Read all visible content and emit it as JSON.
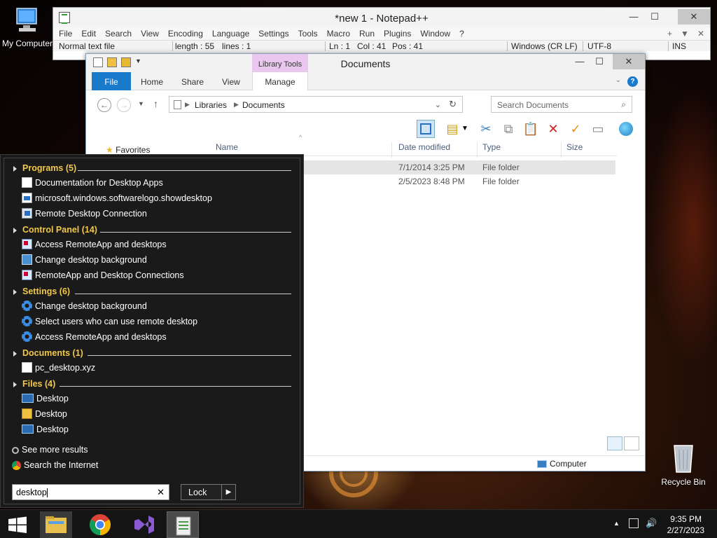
{
  "desktop": {
    "my_computer": "My Computer",
    "recycle_bin": "Recycle Bin"
  },
  "notepad": {
    "title": "*new 1 - Notepad++",
    "menu": [
      "File",
      "Edit",
      "Search",
      "View",
      "Encoding",
      "Language",
      "Settings",
      "Tools",
      "Macro",
      "Run",
      "Plugins",
      "Window",
      "?"
    ],
    "menu_right": [
      "+",
      "▼",
      "✕"
    ],
    "status": {
      "type": "Normal text file",
      "length": "length : 55",
      "lines": "lines : 1",
      "ln": "Ln : 1",
      "col": "Col : 41",
      "pos": "Pos : 41",
      "eol": "Windows (CR LF)",
      "encoding": "UTF-8",
      "mode": "INS"
    }
  },
  "explorer": {
    "title": "Documents",
    "library_tools": "Library Tools",
    "tabs": [
      "File",
      "Home",
      "Share",
      "View",
      "Manage"
    ],
    "breadcrumb": [
      "Libraries",
      "Documents"
    ],
    "search_placeholder": "Search Documents",
    "columns": [
      "Name",
      "Date modified",
      "Type",
      "Size"
    ],
    "rows": [
      {
        "date": "7/1/2014 3:25 PM",
        "type": "File folder"
      },
      {
        "date": "2/5/2023 8:48 PM",
        "type": "File folder"
      }
    ],
    "nav_favorites": "Favorites",
    "status_location": "Computer"
  },
  "start_menu": {
    "categories": [
      {
        "label": "Programs (5)",
        "items": [
          "Documentation for Desktop Apps",
          "microsoft.windows.softwarelogo.showdesktop",
          "Remote Desktop Connection"
        ]
      },
      {
        "label": "Control Panel (14)",
        "items": [
          "Access RemoteApp and desktops",
          "Change desktop background",
          "RemoteApp and Desktop Connections"
        ]
      },
      {
        "label": "Settings (6)",
        "items": [
          "Change desktop background",
          "Select users who can use remote desktop",
          "Access RemoteApp and desktops"
        ]
      },
      {
        "label": "Documents (1)",
        "items": [
          "pc_desktop.xyz"
        ]
      },
      {
        "label": "Files (4)",
        "items": [
          "Desktop",
          "Desktop",
          "Desktop"
        ]
      }
    ],
    "see_more": "See more results",
    "search_internet": "Search the Internet",
    "search_value": "desktop",
    "lock_label": "Lock"
  },
  "taskbar": {
    "time": "9:35 PM",
    "date": "2/27/2023"
  }
}
